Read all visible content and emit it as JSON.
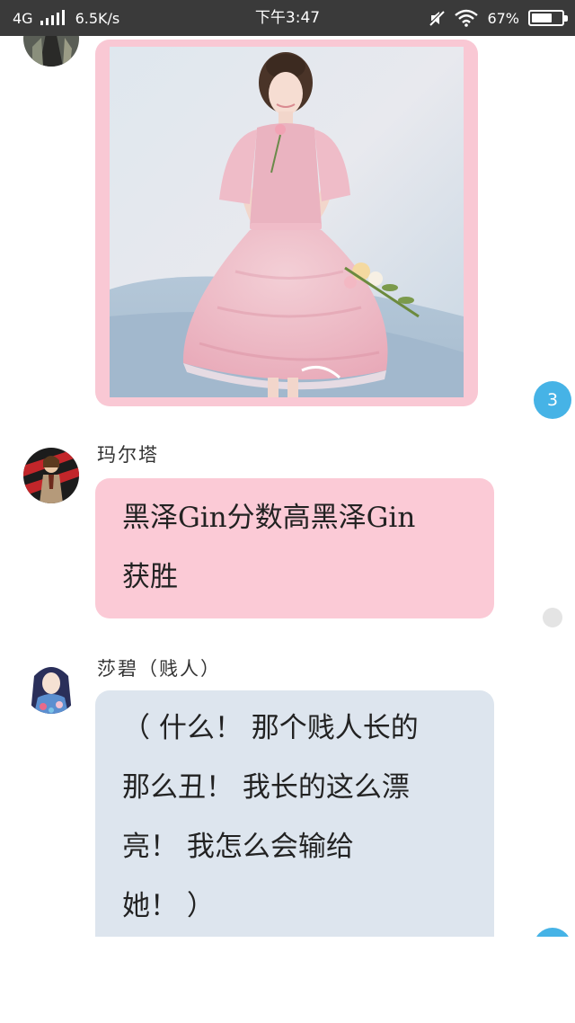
{
  "status_bar": {
    "network": "4G",
    "speed": "6.5K/s",
    "time": "下午3:47",
    "battery": "67%",
    "icons": [
      "signal-icon",
      "mute-icon",
      "wifi-icon",
      "battery-icon"
    ]
  },
  "messages": [
    {
      "type": "image",
      "image_description": "pink-lace-dress-photo"
    },
    {
      "type": "text",
      "sender": "玛尔塔",
      "text": "黑泽Gin分数高黑泽Gin获胜",
      "lines": [
        "黑泽Gin分数高黑泽Gin",
        "获胜"
      ],
      "bubble_color": "#fbcad6"
    },
    {
      "type": "text",
      "sender": "莎碧（贱人）",
      "text": "（什么！那个贱人长的那么丑！我长的这么漂亮！我怎么会输给她！）",
      "lines": [
        "（ 什么！ 那个贱人长的",
        "那么丑！ 我长的这么漂",
        "亮！ 我怎么会输给",
        "她！ ）"
      ],
      "bubble_color": "#dde5ee"
    }
  ],
  "unread_badge": {
    "count": "3",
    "color": "#46b3e6"
  }
}
